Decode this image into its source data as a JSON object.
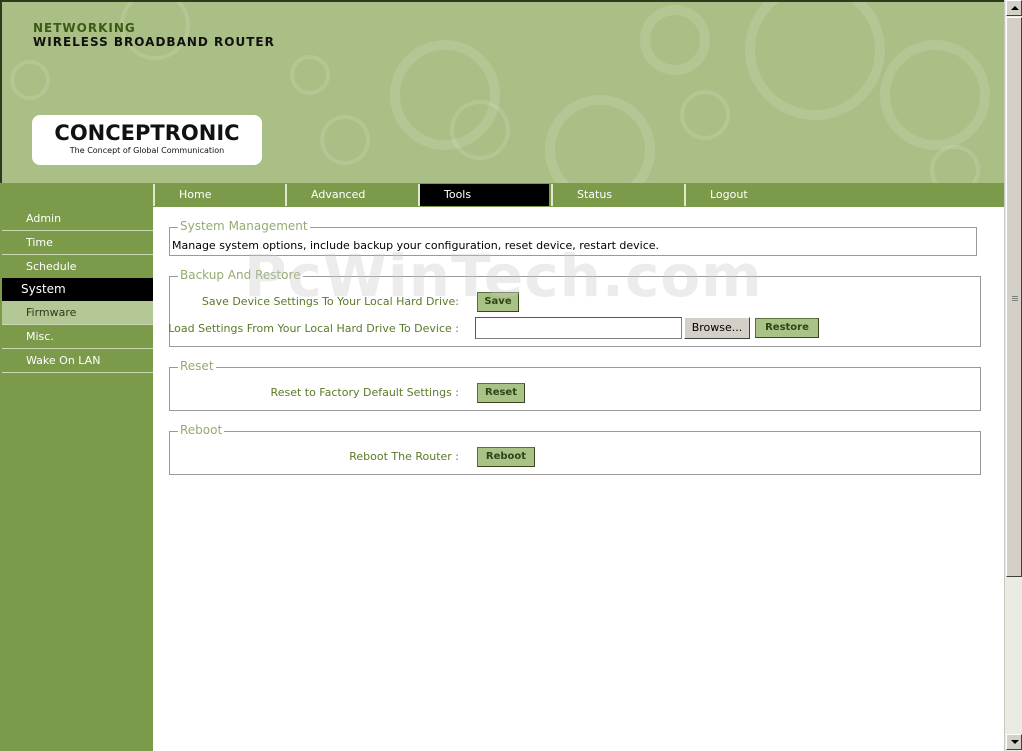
{
  "header": {
    "line1": "NETWORKING",
    "line2": "WIRELESS BROADBAND ROUTER",
    "logo_name": "CONCEPTRONIC",
    "logo_tagline": "The Concept of Global Communication"
  },
  "nav": {
    "tabs": [
      {
        "label": "Home"
      },
      {
        "label": "Advanced"
      },
      {
        "label": "Tools"
      },
      {
        "label": "Status"
      },
      {
        "label": "Logout"
      }
    ],
    "active_tab": "Tools"
  },
  "sidebar": {
    "items": [
      {
        "label": "Admin"
      },
      {
        "label": "Time"
      },
      {
        "label": "Schedule"
      },
      {
        "label": "System"
      },
      {
        "label": "Firmware"
      },
      {
        "label": "Misc."
      },
      {
        "label": "Wake On LAN"
      }
    ],
    "active_item": "System"
  },
  "system_management": {
    "legend": "System Management",
    "description": "Manage system options, include backup your configuration, reset device, restart device."
  },
  "backup_restore": {
    "legend": "Backup And Restore",
    "save_label": "Save Device Settings To Your Local Hard Drive:",
    "save_button": "Save",
    "load_label": "Load Settings From Your Local Hard Drive To Device :",
    "file_value": "",
    "browse_button": "Browse...",
    "restore_button": "Restore"
  },
  "reset": {
    "legend": "Reset",
    "label": "Reset to Factory Default Settings :",
    "button": "Reset"
  },
  "reboot": {
    "legend": "Reboot",
    "label": "Reboot The Router :",
    "button": "Reboot"
  },
  "watermark": "PcWinTech.com",
  "colors": {
    "banner": "#a9bf86",
    "sidebar": "#7b9a4a",
    "active": "#000000",
    "legend_text": "#95ab72",
    "label_text": "#5a7a28",
    "button_bg": "#a9c286"
  }
}
